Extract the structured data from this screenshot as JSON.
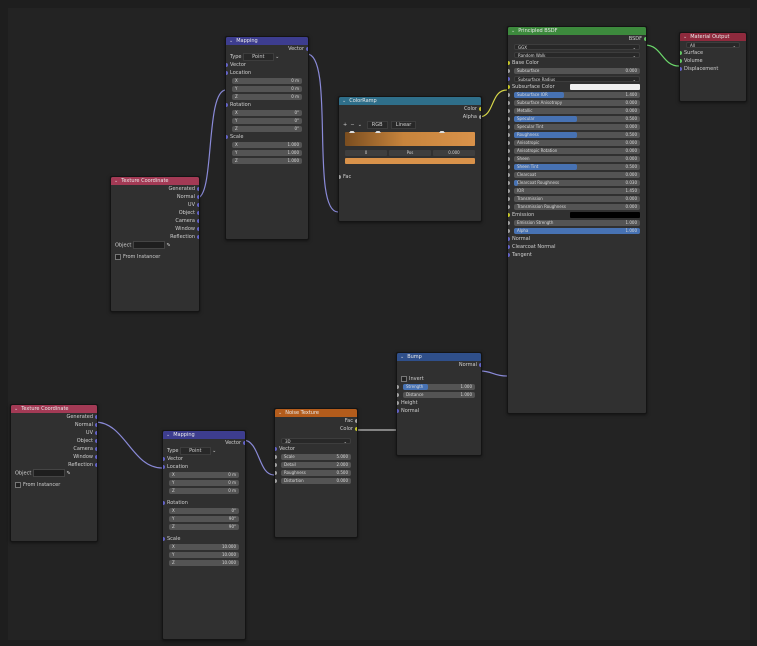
{
  "nodes": {
    "texcoord1": {
      "title": "Texture Coordinate",
      "outputs": [
        "Generated",
        "Normal",
        "UV",
        "Object",
        "Camera",
        "Window",
        "Reflection"
      ],
      "object_label": "Object",
      "from_instancer": "From Instancer"
    },
    "mapping1": {
      "title": "Mapping",
      "output": "Vector",
      "type_label": "Type",
      "type_value": "Point",
      "vector_label": "Vector",
      "location_label": "Location",
      "location": [
        {
          "axis": "X",
          "value": "0 m"
        },
        {
          "axis": "Y",
          "value": "0 m"
        },
        {
          "axis": "Z",
          "value": "0 m"
        }
      ],
      "rotation_label": "Rotation",
      "rotation": [
        {
          "axis": "X",
          "value": "0°"
        },
        {
          "axis": "Y",
          "value": "0°"
        },
        {
          "axis": "Z",
          "value": "0°"
        }
      ],
      "scale_label": "Scale",
      "scale": [
        {
          "axis": "X",
          "value": "1.000"
        },
        {
          "axis": "Y",
          "value": "1.000"
        },
        {
          "axis": "Z",
          "value": "1.000"
        }
      ]
    },
    "colorramp": {
      "title": "ColorRamp",
      "out_color": "Color",
      "out_alpha": "Alpha",
      "mode": "RGB",
      "interp": "Linear",
      "index": "0",
      "pos_label": "Pos",
      "pos_value": "0.000",
      "fac": "Fac"
    },
    "principled": {
      "title": "Principled BSDF",
      "output": "BSDF",
      "dist": "GGX",
      "sss_method": "Random Walk",
      "base_color": "Base Color",
      "subsurface": {
        "label": "Subsurface",
        "value": "0.000"
      },
      "subsurface_radius": "Subsurface Radius",
      "subsurface_color": "Subsurface Color",
      "params": [
        {
          "label": "Subsurface IOR",
          "value": "1.400",
          "fill": 0.4
        },
        {
          "label": "Subsurface Anisotropy",
          "value": "0.000",
          "fill": 0
        },
        {
          "label": "Metallic",
          "value": "0.000",
          "fill": 0
        },
        {
          "label": "Specular",
          "value": "0.500",
          "fill": 0.5
        },
        {
          "label": "Specular Tint",
          "value": "0.000",
          "fill": 0
        },
        {
          "label": "Roughness",
          "value": "0.500",
          "fill": 0.5
        },
        {
          "label": "Anisotropic",
          "value": "0.000",
          "fill": 0
        },
        {
          "label": "Anisotropic Rotation",
          "value": "0.000",
          "fill": 0
        },
        {
          "label": "Sheen",
          "value": "0.000",
          "fill": 0
        },
        {
          "label": "Sheen Tint",
          "value": "0.500",
          "fill": 0.5
        },
        {
          "label": "Clearcoat",
          "value": "0.000",
          "fill": 0
        },
        {
          "label": "Clearcoat Roughness",
          "value": "0.030",
          "fill": 0.03
        },
        {
          "label": "IOR",
          "value": "1.450",
          "fill": 0
        },
        {
          "label": "Transmission",
          "value": "0.000",
          "fill": 0
        },
        {
          "label": "Transmission Roughness",
          "value": "0.000",
          "fill": 0
        }
      ],
      "emission": "Emission",
      "emission_strength": {
        "label": "Emission Strength",
        "value": "1.000"
      },
      "alpha": {
        "label": "Alpha",
        "value": "1.000"
      },
      "normal": "Normal",
      "clearcoat_normal": "Clearcoat Normal",
      "tangent": "Tangent"
    },
    "matout": {
      "title": "Material Output",
      "target": "All",
      "inputs": [
        "Surface",
        "Volume",
        "Displacement"
      ]
    },
    "bump": {
      "title": "Bump",
      "output": "Normal",
      "invert": "Invert",
      "strength": {
        "label": "Strength",
        "value": "1.000"
      },
      "distance": {
        "label": "Distance",
        "value": "1.000"
      },
      "height": "Height",
      "normal": "Normal"
    },
    "noise": {
      "title": "Noise Texture",
      "out_fac": "Fac",
      "out_color": "Color",
      "dim": "3D",
      "vector": "Vector",
      "params": [
        {
          "label": "Scale",
          "value": "5.000"
        },
        {
          "label": "Detail",
          "value": "2.000"
        },
        {
          "label": "Roughness",
          "value": "0.500"
        },
        {
          "label": "Distortion",
          "value": "0.000"
        }
      ]
    },
    "texcoord2": {
      "title": "Texture Coordinate",
      "outputs": [
        "Generated",
        "Normal",
        "UV",
        "Object",
        "Camera",
        "Window",
        "Reflection"
      ],
      "object_label": "Object",
      "from_instancer": "From Instancer"
    },
    "mapping2": {
      "title": "Mapping",
      "output": "Vector",
      "type_label": "Type",
      "type_value": "Point",
      "vector_label": "Vector",
      "location_label": "Location",
      "location": [
        {
          "axis": "X",
          "value": "0 m"
        },
        {
          "axis": "Y",
          "value": "0 m"
        },
        {
          "axis": "Z",
          "value": "0 m"
        }
      ],
      "rotation_label": "Rotation",
      "rotation": [
        {
          "axis": "X",
          "value": "0°"
        },
        {
          "axis": "Y",
          "value": "90°"
        },
        {
          "axis": "Z",
          "value": "90°"
        }
      ],
      "scale_label": "Scale",
      "scale": [
        {
          "axis": "X",
          "value": "10.000"
        },
        {
          "axis": "Y",
          "value": "10.000"
        },
        {
          "axis": "Z",
          "value": "10.000"
        }
      ]
    }
  },
  "colors": {
    "hdr_input": "#a33a55",
    "hdr_vector": "#3d3d8f",
    "hdr_converter": "#2f6f8a",
    "hdr_shader": "#3d8a3d",
    "hdr_output": "#8f2a3d",
    "hdr_texture": "#b35c1c"
  }
}
